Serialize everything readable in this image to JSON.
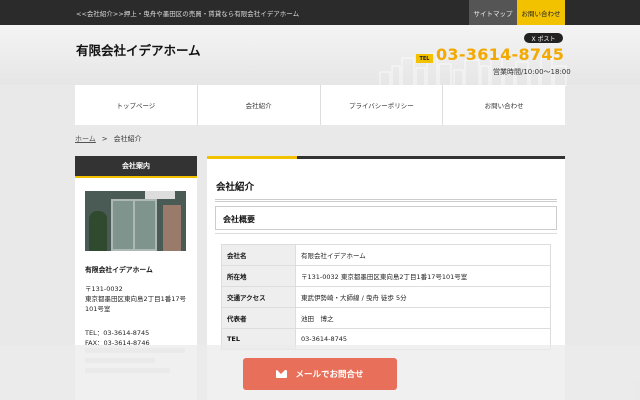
{
  "topbar": {
    "tagline": "<<会社紹介>>押上・曳舟や墨田区の売買・賃貸なら有限会社イデアホーム",
    "sitemap_label": "サイトマップ",
    "contact_label": "お問い合わせ"
  },
  "header": {
    "site_title": "有限会社イデアホーム",
    "post_label": "X ポスト",
    "tel_badge": "TEL",
    "tel_number": "03-3614-8745",
    "hours": "営業時間/10:00～18:00"
  },
  "nav": {
    "items": [
      {
        "label": "トップページ"
      },
      {
        "label": "会社紹介"
      },
      {
        "label": "プライバシーポリシー"
      },
      {
        "label": "お問い合わせ"
      }
    ]
  },
  "breadcrumb": {
    "home": "ホーム",
    "separator": ">",
    "current": "会社紹介"
  },
  "sidebar": {
    "heading": "会社案内",
    "company_name": "有限会社イデアホーム",
    "postal": "〒131-0032",
    "address": "東京都墨田区東向島2丁目1番17号101号室",
    "tel": "TEL：03-3614-8745",
    "fax": "FAX：03-3614-8746"
  },
  "main": {
    "page_heading": "会社紹介",
    "section_heading": "会社概要",
    "rows": [
      {
        "label": "会社名",
        "value": "有限会社イデアホーム"
      },
      {
        "label": "所在地",
        "value": "〒131-0032 東京都墨田区東向島2丁目1番17号101号室"
      },
      {
        "label": "交通アクセス",
        "value": "東武伊勢崎・大師線 / 曳舟 徒歩 5分"
      },
      {
        "label": "代表者",
        "value": "池田　博之"
      },
      {
        "label": "TEL",
        "value": "03-3614-8745"
      }
    ]
  },
  "cta": {
    "mail_label": "メールでお問合せ"
  },
  "colors": {
    "accent_yellow": "#f2c200",
    "tel_orange": "#f2a900",
    "cta_coral": "#e8705a",
    "dark": "#2b2b2b"
  }
}
